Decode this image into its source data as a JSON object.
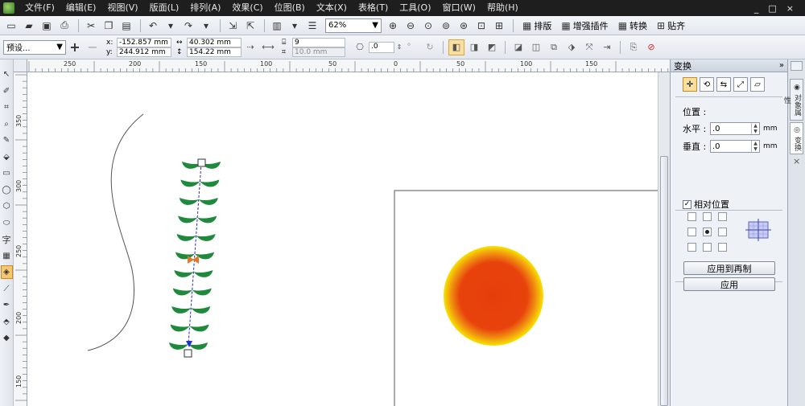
{
  "menu": [
    "文件(F)",
    "编辑(E)",
    "视图(V)",
    "版面(L)",
    "排列(A)",
    "效果(C)",
    "位图(B)",
    "文本(X)",
    "表格(T)",
    "工具(O)",
    "窗口(W)",
    "帮助(H)"
  ],
  "window_controls": [
    "_",
    "□",
    "×"
  ],
  "toolbar": {
    "zoom": "62%",
    "text_buttons": [
      "排版",
      "增强插件",
      "转换",
      "贴齐"
    ]
  },
  "propbar": {
    "preset": "预设...",
    "x": "-152.857 mm",
    "y": "244.912 mm",
    "width": "40.302 mm",
    "height": "154.22 mm",
    "steps": "9",
    "spacing": "10.0 mm",
    "angle": ".0",
    "plus": "+",
    "minus": "−",
    "degree": "°"
  },
  "ruler_top_labels": [
    "250",
    "200",
    "150",
    "100",
    "50",
    "0",
    "50",
    "100",
    "150"
  ],
  "ruler_left_labels": [
    "350",
    "300",
    "250",
    "200",
    "150"
  ],
  "docker": {
    "title": "变换",
    "chevron": "»",
    "section": "位置 :",
    "horizontal_label": "水平 :",
    "horizontal_value": ".0",
    "vertical_label": "垂直 :",
    "vertical_value": ".0",
    "unit": "mm",
    "relative_label": "相对位置",
    "relative_checked": "✓",
    "apply_duplicate": "应用到再制",
    "apply": "应用"
  },
  "side_tabs": [
    "对象属性",
    "变换"
  ],
  "side_close": "×",
  "colors": {
    "leaf": "#1f8a3c",
    "circle_center": "#e63e0b",
    "circle_edge": "#f7e300",
    "highlight": "#f9dfa0"
  }
}
